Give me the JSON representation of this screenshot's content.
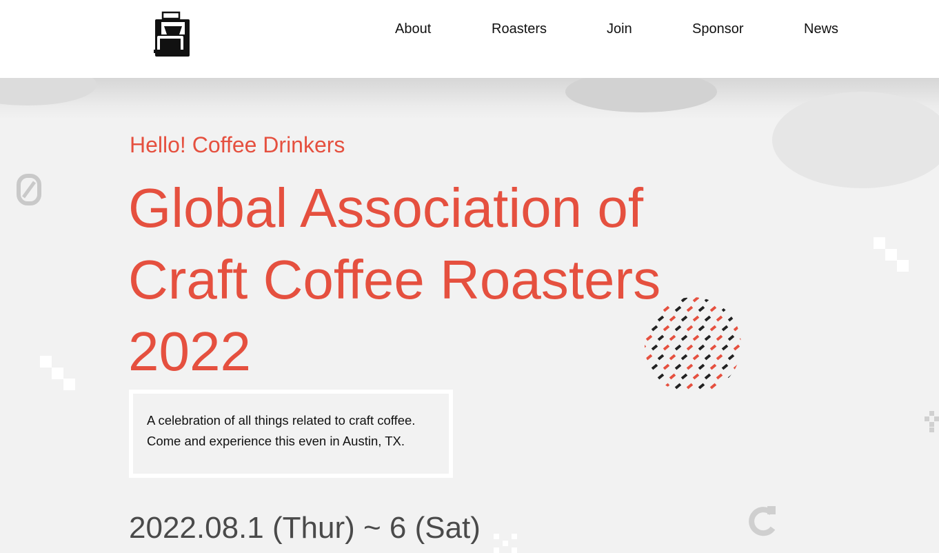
{
  "nav": {
    "logo_name": "coffee-maker-icon",
    "items": [
      "About",
      "Roasters",
      "Join",
      "Sponsor",
      "News"
    ]
  },
  "hero": {
    "greeting": "Hello! Coffee Drinkers",
    "title_lines": [
      "Global Association of",
      "Craft Coffee Roasters",
      "2022"
    ],
    "description_lines": [
      "A celebration of all things related to craft coffee.",
      "Come and experience this even in Austin, TX."
    ],
    "date": "2022.08.1 (Thur) ~ 6 (Sat)"
  },
  "colors": {
    "accent": "#e5503f",
    "dark": "#222222",
    "background": "#f2f2f2"
  }
}
